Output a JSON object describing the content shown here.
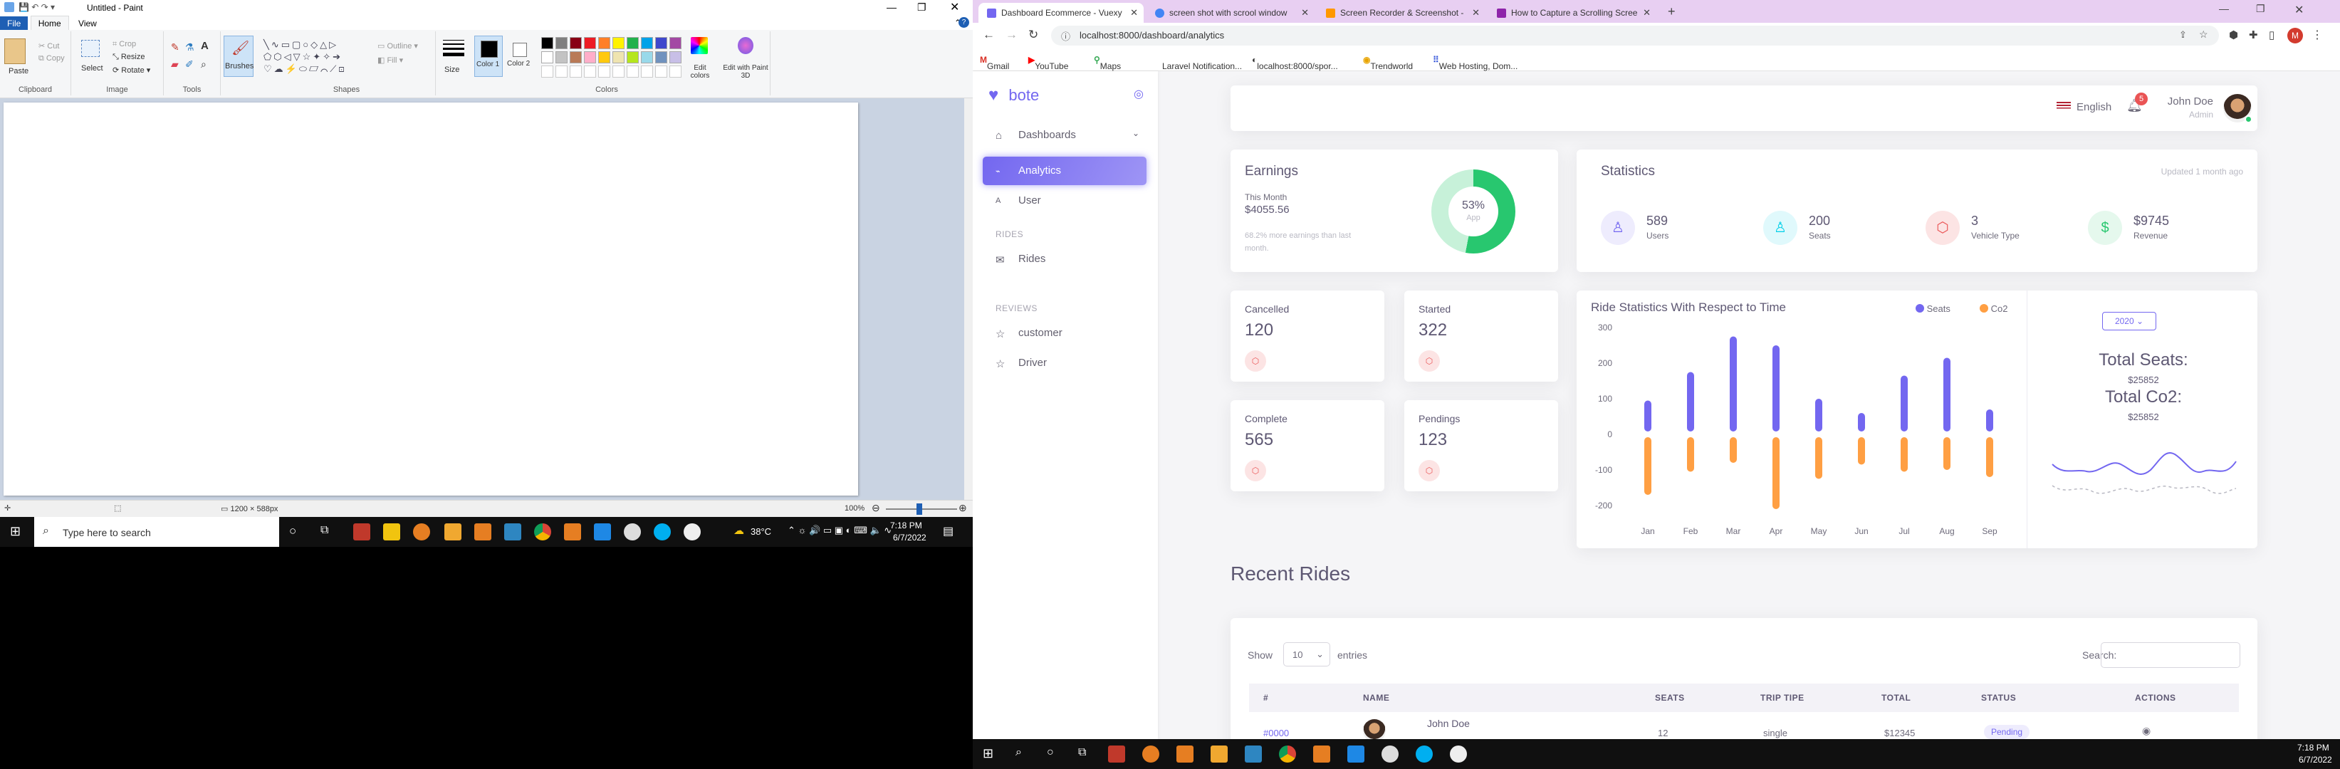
{
  "paint": {
    "title": "Untitled - Paint",
    "menu": [
      "File",
      "Home",
      "View"
    ],
    "clipboard": {
      "paste": "Paste",
      "cut": "Cut",
      "copy": "Copy",
      "label": "Clipboard"
    },
    "image": {
      "select": "Select",
      "crop": "Crop",
      "resize": "Resize",
      "rotate": "Rotate",
      "label": "Image"
    },
    "tools_label": "Tools",
    "brushes": "Brushes",
    "shapes": {
      "outline": "Outline",
      "fill": "Fill",
      "label": "Shapes"
    },
    "size": "Size",
    "color1": "Color 1",
    "color2": "Color 2",
    "colors_label": "Colors",
    "edit_colors": "Edit colors",
    "edit_3d": "Edit with Paint 3D",
    "palette": [
      "#000000",
      "#7f7f7f",
      "#880015",
      "#ed1c24",
      "#ff7f27",
      "#fff200",
      "#22b14c",
      "#00a2e8",
      "#3f48cc",
      "#a349a4",
      "#ffffff",
      "#c3c3c3",
      "#b97a57",
      "#ffaec9",
      "#ffc90e",
      "#efe4b0",
      "#b5e61d",
      "#99d9ea",
      "#7092be",
      "#c8bfe7"
    ],
    "status_size": "1200 × 588px",
    "zoom": "100%"
  },
  "taskbar_left": {
    "search_placeholder": "Type here to search",
    "weather": "38°C",
    "time": "7:18 PM",
    "date": "6/7/2022"
  },
  "chrome": {
    "tabs": [
      {
        "title": "Dashboard Ecommerce - Vuexy",
        "color": "#7367f0"
      },
      {
        "title": "screen shot with scrool window",
        "color": "#4285f4"
      },
      {
        "title": "Screen Recorder & Screenshot - ",
        "color": "#ff9800"
      },
      {
        "title": "How to Capture a Scrolling Scree",
        "color": "#8e24aa"
      }
    ],
    "url": "localhost:8000/dashboard/analytics",
    "bookmarks": [
      "Gmail",
      "YouTube",
      "Maps",
      "Laravel Notification...",
      "localhost:8000/spor...",
      "Trendworld",
      "Web Hosting, Dom..."
    ]
  },
  "app": {
    "brand": "bote",
    "nav": {
      "dashboards": "Dashboards",
      "analytics": "Analytics",
      "user": "User",
      "rides_section": "RIDES",
      "rides": "Rides",
      "reviews_section": "REVIEWS",
      "customer": "customer",
      "driver": "Driver"
    },
    "header": {
      "language": "English",
      "notif_count": "5",
      "user_name": "John Doe",
      "user_role": "Admin"
    },
    "earnings": {
      "title": "Earnings",
      "subtitle": "This Month",
      "amount": "$4055.56",
      "note": "68.2% more earnings than last month.",
      "percent": 53,
      "percent_label": "53%",
      "center_label": "App"
    },
    "statistics": {
      "title": "Statistics",
      "updated": "Updated 1 month ago",
      "items": [
        {
          "value": "589",
          "label": "Users",
          "icon": "user-icon",
          "glyph": "♙",
          "color": "#7367f0",
          "bg": "#eeecfd"
        },
        {
          "value": "200",
          "label": "Seats",
          "icon": "user-icon",
          "glyph": "♙",
          "color": "#00cfe8",
          "bg": "#e0f9fc"
        },
        {
          "value": "3",
          "label": "Vehicle Type",
          "icon": "box-icon",
          "glyph": "⬡",
          "color": "#ea5455",
          "bg": "#fce4e4"
        },
        {
          "value": "$9745",
          "label": "Revenue",
          "icon": "dollar-icon",
          "glyph": "$",
          "color": "#28c76f",
          "bg": "#e5f8ed"
        }
      ]
    },
    "mini": [
      {
        "label": "Cancelled",
        "value": "120"
      },
      {
        "label": "Started",
        "value": "322"
      },
      {
        "label": "Complete",
        "value": "565"
      },
      {
        "label": "Pendings",
        "value": "123"
      }
    ],
    "ride_stats": {
      "title": "Ride Statistics With Respect to Time",
      "year": "2020",
      "total_seats_label": "Total Seats:",
      "total_seats": "$25852",
      "total_co2_label": "Total Co2:",
      "total_co2": "$25852"
    },
    "recent": {
      "title": "Recent Rides",
      "show": "Show",
      "entries_value": "10",
      "entries": "entries",
      "search": "Search:",
      "columns": [
        "#",
        "NAME",
        "SEATS",
        "TRIP TIPE",
        "TOTAL",
        "STATUS",
        "ACTIONS"
      ],
      "row": {
        "id": "#0000",
        "name": "John Doe",
        "seats": "12",
        "trip": "single",
        "total": "$12345",
        "status": "Pending"
      }
    }
  },
  "taskbar_right": {
    "time": "7:18 PM",
    "date": "6/7/2022"
  },
  "chart_data": {
    "type": "bar",
    "title": "Ride Statistics With Respect to Time",
    "categories": [
      "Jan",
      "Feb",
      "Mar",
      "Apr",
      "May",
      "Jun",
      "Jul",
      "Aug",
      "Sep"
    ],
    "series": [
      {
        "name": "Seats",
        "color": "#7367f0",
        "values": [
          95,
          175,
          275,
          250,
          100,
          60,
          165,
          215,
          70
        ]
      },
      {
        "name": "Co2",
        "color": "#ff9f43",
        "values": [
          -170,
          -105,
          -80,
          -210,
          -125,
          -85,
          -105,
          -100,
          -120
        ]
      }
    ],
    "ylim": [
      -200,
      300
    ],
    "yticks": [
      300,
      200,
      100,
      0,
      -100,
      -200
    ],
    "legend": "top-right"
  }
}
